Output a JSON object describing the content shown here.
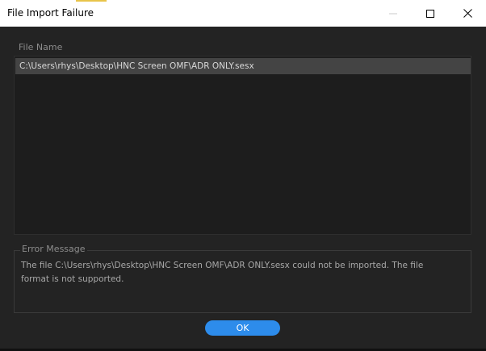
{
  "window": {
    "title": "File Import Failure"
  },
  "file_list": {
    "header": "File Name",
    "items": [
      "C:\\Users\\rhys\\Desktop\\HNC Screen OMF\\ADR ONLY.sesx"
    ]
  },
  "error": {
    "header": "Error Message",
    "message": "The file C:\\Users\\rhys\\Desktop\\HNC Screen OMF\\ADR ONLY.sesx could not be imported. The file format is not supported."
  },
  "buttons": {
    "ok_label": "OK"
  },
  "colors": {
    "accent": "#2d8ceb",
    "background": "#232323",
    "selected_row": "#444444"
  },
  "icons": {
    "minimize": "minimize-icon",
    "maximize": "maximize-icon",
    "close": "close-icon"
  }
}
